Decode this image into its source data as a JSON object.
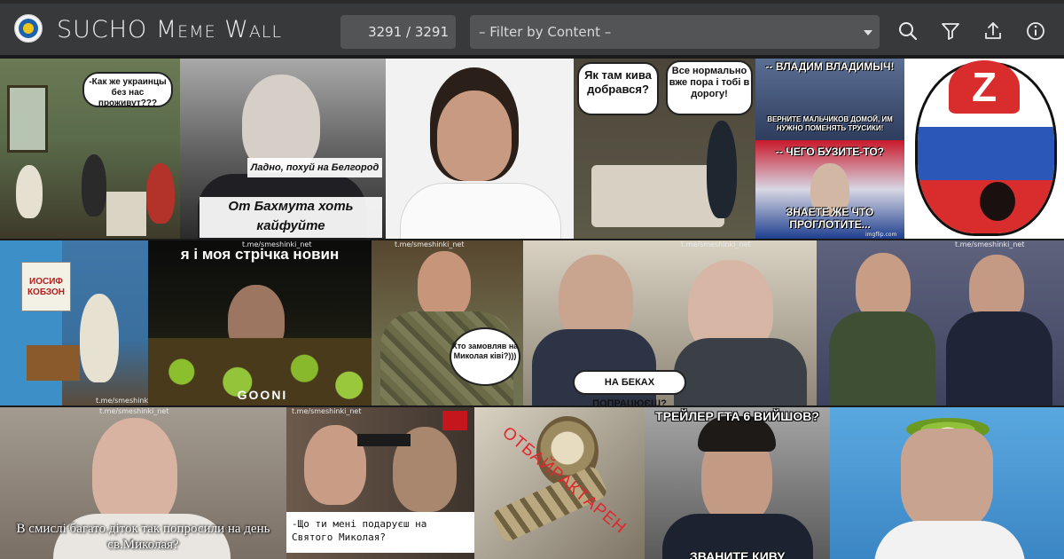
{
  "header": {
    "title": "SUCHO Meme Wall",
    "counter": "3291 / 3291",
    "filter_placeholder": "– Filter by Content –",
    "icons": [
      "search-icon",
      "filter-icon",
      "upload-icon",
      "info-icon"
    ]
  },
  "colors": {
    "header_bg": "#38393a",
    "control_bg": "#535455",
    "text": "#ececec"
  },
  "memes": {
    "m1": {
      "caption": "-Как же украинцы без нас проживут???"
    },
    "m2": {
      "caption1": "Ладно, похуй на Белгород",
      "caption2": "От Бахмута хоть кайфуйте"
    },
    "m4": {
      "bubble1": "Як там кива добрався?",
      "bubble2": "Все нормально вже пора і тобі в дорогу!"
    },
    "m5": {
      "top": "-- ВЛАДИМ ВЛАДИМЫЧ!",
      "mid": "ВЕРНИТЕ МАЛЬЧИКОВ ДОМОЙ, ИМ НУЖНО ПОМЕНЯТЬ ТРУСИКИ!",
      "q": "-- ЧЕГО БУЗИТЕ-ТО?",
      "a": "ЗНАЕТЕ ЖЕ ЧТО ПРОГЛОТИТЕ...",
      "wm": "imgflip.com"
    },
    "m6": {
      "letter": "Z"
    },
    "m7": {
      "poster": "ИОСИФ КОБЗОН",
      "wm": "t.me/smeshinki_net"
    },
    "m8": {
      "caption": "я і моя стрічка новин",
      "wm": "t.me/smeshinki_net",
      "logo": "GOONI"
    },
    "m9": {
      "bubble": "Хто замовляв на Миколая ківі?)))",
      "wm": "t.me/smeshinki_net"
    },
    "m10": {
      "caption": "НА БЕКАХ ПОПРАЦЮЄШ?",
      "wm": "t.me/smeshinki_net"
    },
    "m11": {
      "wm": "t.me/smeshinki_net"
    },
    "m12": {
      "caption": "В смислі багато діток так попросили на день св.Миколая?",
      "wm": "t.me/smeshinki_net"
    },
    "m13": {
      "caption": "-Що ти мені подаруєш на Святого Миколая?",
      "wm": "t.me/smeshinki_net"
    },
    "m14": {
      "stamp": "ОТБАЙРАКТАРЕН"
    },
    "m15": {
      "caption": "ТРЕЙЛЕР ГТА 6 ВИЙШОВ?",
      "bottom": "ЗВАНИТЕ КИВУ"
    }
  }
}
